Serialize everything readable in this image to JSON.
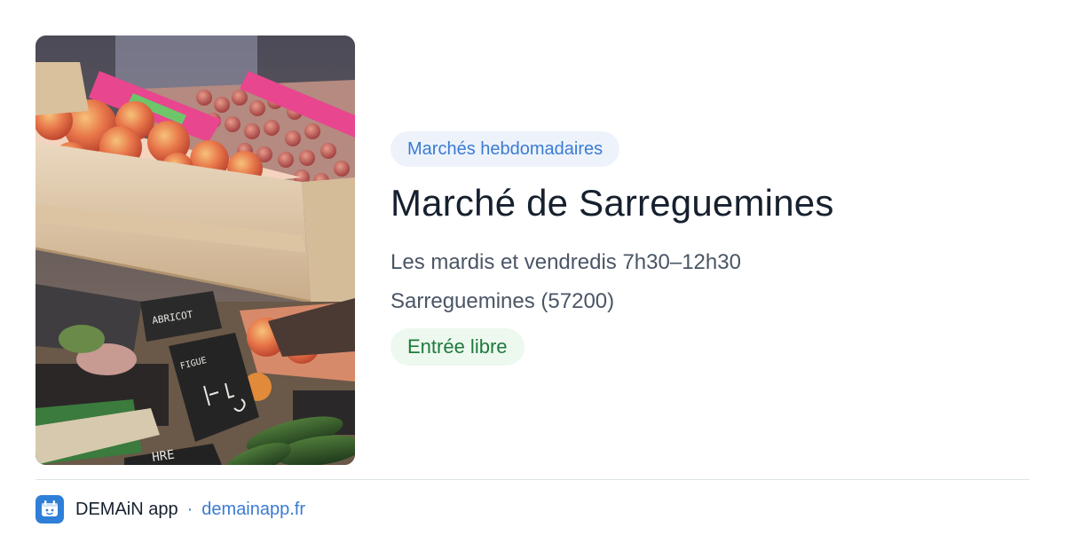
{
  "event": {
    "category": "Marchés hebdomadaires",
    "title": "Marché de Sarreguemines",
    "schedule": "Les mardis et vendredis 7h30–12h30",
    "location": "Sarreguemines (57200)",
    "price": "Entrée libre",
    "image_subject": "market stall with fruit crates and chalkboard price signs",
    "sign_text_1": "ABRICOT",
    "sign_text_2": "FIGUE",
    "sign_text_3": "HRE"
  },
  "footer": {
    "app_name": "DEMAiN app",
    "separator": "·",
    "domain": "demainapp.fr",
    "logo_icon": "demain-logo-icon"
  },
  "colors": {
    "category_bg": "#eef3fb",
    "category_text": "#3b7bd4",
    "price_bg": "#edf8ef",
    "price_text": "#1f7a3d",
    "title_text": "#16202e",
    "body_text": "#4a5565",
    "link_text": "#3b7bd4",
    "logo_bg": "#2f7fd8"
  }
}
